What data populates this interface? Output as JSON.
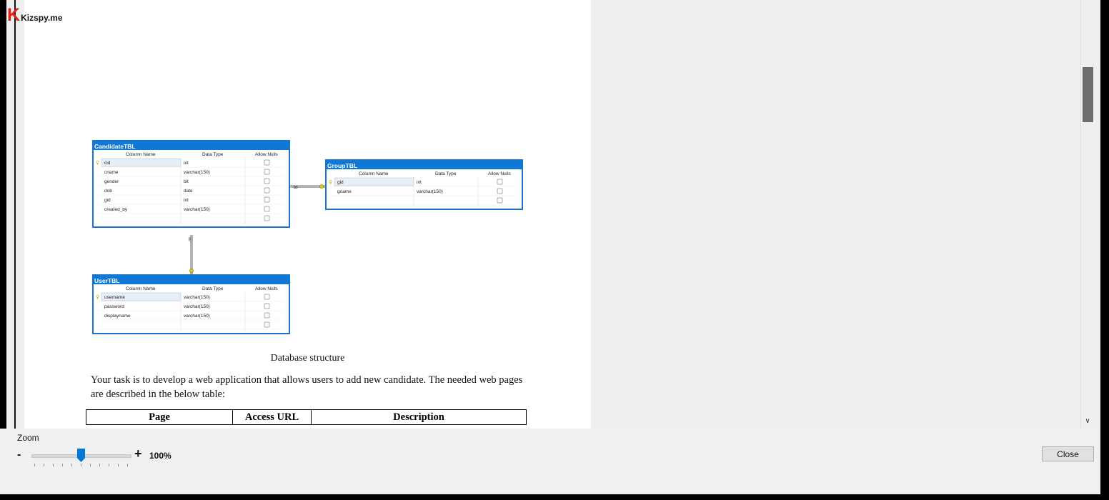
{
  "logo": {
    "mark": "K",
    "name": "Kizspy.me"
  },
  "diagram": {
    "headers": [
      "Column Name",
      "Data Type",
      "Allow Nulls"
    ],
    "tables": [
      {
        "name": "CandidateTBL",
        "rows": [
          {
            "col": "cid",
            "type": "int",
            "key": true
          },
          {
            "col": "cname",
            "type": "varchar(150)",
            "key": false
          },
          {
            "col": "gender",
            "type": "bit",
            "key": false
          },
          {
            "col": "dob",
            "type": "date",
            "key": false
          },
          {
            "col": "gid",
            "type": "int",
            "key": false
          },
          {
            "col": "created_by",
            "type": "varchar(150)",
            "key": false
          },
          {
            "col": "",
            "type": "",
            "key": false
          }
        ]
      },
      {
        "name": "GroupTBL",
        "rows": [
          {
            "col": "gid",
            "type": "int",
            "key": true
          },
          {
            "col": "gname",
            "type": "varchar(150)",
            "key": false
          },
          {
            "col": "",
            "type": "",
            "key": false
          }
        ]
      },
      {
        "name": "UserTBL",
        "rows": [
          {
            "col": "username",
            "type": "varchar(150)",
            "key": true
          },
          {
            "col": "password",
            "type": "varchar(150)",
            "key": false
          },
          {
            "col": "displayname",
            "type": "varchar(150)",
            "key": false
          },
          {
            "col": "",
            "type": "",
            "key": false
          }
        ]
      }
    ]
  },
  "caption": "Database structure",
  "paragraph": "Your task is to develop a web application that allows users to add new candidate. The needed web pages are described in the below table:",
  "doc_table": {
    "headers": [
      "Page",
      "Access URL",
      "Description"
    ]
  },
  "controls": {
    "zoom_label": "Zoom",
    "zoom_minus": "-",
    "zoom_plus": "+",
    "zoom_value": "100%",
    "zoom_level_percent": 100,
    "close_label": "Close"
  }
}
